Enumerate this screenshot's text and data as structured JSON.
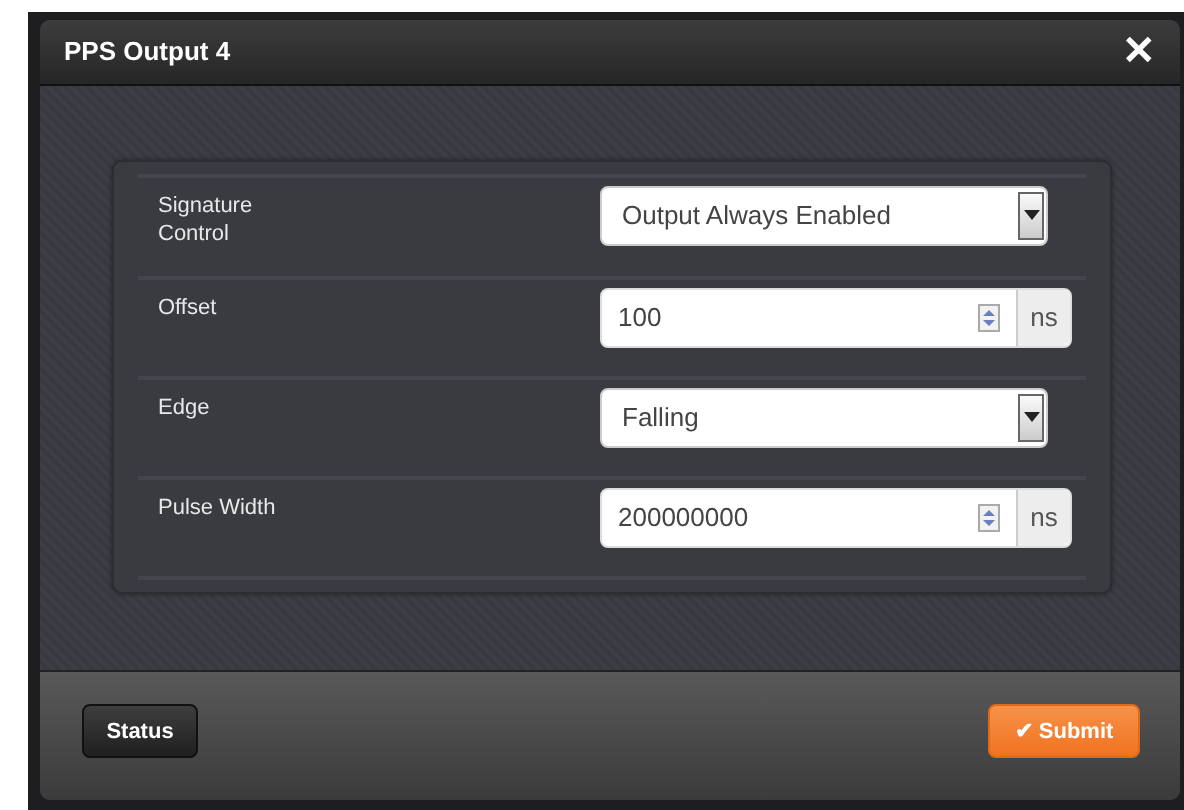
{
  "dialog": {
    "title": "PPS Output 4",
    "close": "✕"
  },
  "fields": [
    {
      "kind": "select",
      "label": "Signature Control",
      "value": "Output Always Enabled"
    },
    {
      "kind": "number",
      "label": "Offset",
      "value": "100",
      "unit": "ns"
    },
    {
      "kind": "select",
      "label": "Edge",
      "value": "Falling"
    },
    {
      "kind": "number",
      "label": "Pulse Width",
      "value": "200000000",
      "unit": "ns"
    }
  ],
  "buttons": {
    "status": "Status",
    "submit": "Submit",
    "submit_icon": "✔"
  }
}
